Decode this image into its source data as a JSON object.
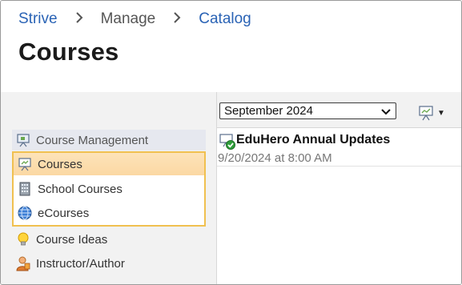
{
  "breadcrumb": {
    "items": [
      {
        "label": "Strive",
        "link": true
      },
      {
        "label": "Manage",
        "link": false
      },
      {
        "label": "Catalog",
        "link": true
      }
    ]
  },
  "page_title": "Courses",
  "sidebar": {
    "root": {
      "label": "Course Management",
      "icon": "presentation-board-icon"
    },
    "items": [
      {
        "label": "Courses",
        "icon": "presentation-board-icon",
        "selected": true
      },
      {
        "label": "School Courses",
        "icon": "building-icon",
        "selected": false
      },
      {
        "label": "eCourses",
        "icon": "globe-icon",
        "selected": false
      },
      {
        "label": "Course Ideas",
        "icon": "lightbulb-icon",
        "selected": false
      },
      {
        "label": "Instructor/Author",
        "icon": "person-icon",
        "selected": false
      }
    ]
  },
  "panel": {
    "month_select": {
      "value": "September 2024"
    },
    "courses": [
      {
        "title": "EduHero Annual Updates",
        "date": "9/20/2024 at 8:00 AM",
        "icon": "course-approved-icon"
      }
    ]
  },
  "colors": {
    "link": "#2a63b5",
    "selection_border": "#f0c050",
    "selection_fill": "#fde3b9",
    "background": "#f2f2f2"
  }
}
